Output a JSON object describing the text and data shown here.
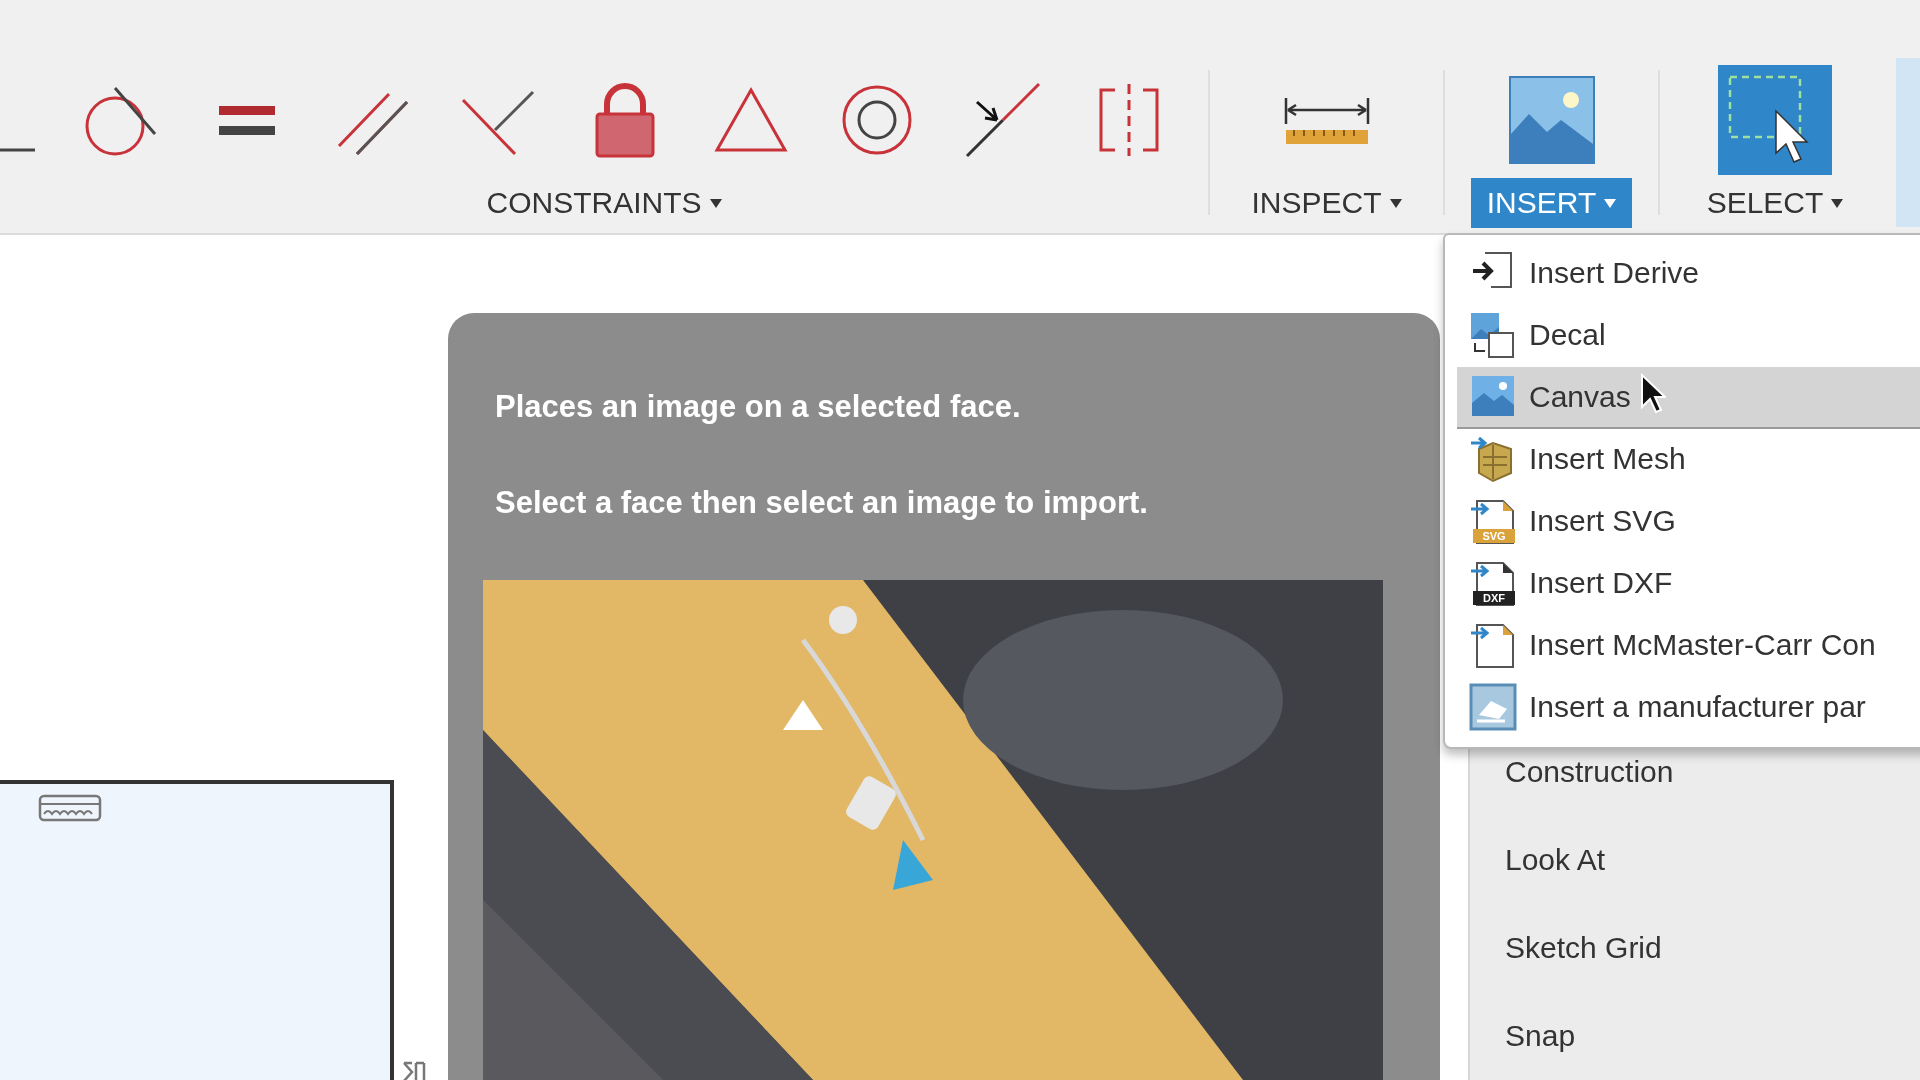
{
  "toolbar": {
    "groups": [
      {
        "label": "CONSTRAINTS",
        "selected": false
      },
      {
        "label": "INSPECT",
        "selected": false
      },
      {
        "label": "INSERT",
        "selected": true
      },
      {
        "label": "SELECT",
        "selected": false
      }
    ]
  },
  "insert_menu": {
    "items": [
      {
        "label": "Insert Derive",
        "selected": false
      },
      {
        "label": "Decal",
        "selected": false
      },
      {
        "label": "Canvas",
        "selected": true
      },
      {
        "label": "Insert Mesh",
        "selected": false
      },
      {
        "label": "Insert SVG",
        "selected": false,
        "badge": "SVG"
      },
      {
        "label": "Insert DXF",
        "selected": false,
        "badge": "DXF"
      },
      {
        "label": "Insert McMaster-Carr Con",
        "selected": false
      },
      {
        "label": "Insert a manufacturer par",
        "selected": false
      }
    ]
  },
  "tooltip": {
    "lines": [
      "Places an image on a selected face.",
      "Select a face then select an image to import."
    ]
  },
  "palette": {
    "items": [
      "Construction",
      "Look At",
      "Sketch Grid",
      "Snap"
    ]
  }
}
